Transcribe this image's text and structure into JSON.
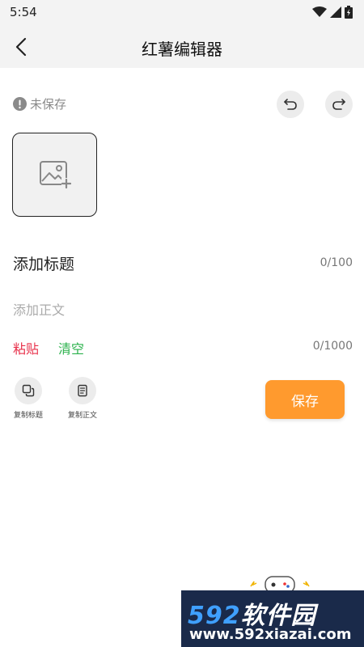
{
  "status_bar": {
    "time": "5:54"
  },
  "app_bar": {
    "title": "红薯编辑器"
  },
  "editor": {
    "save_status": "未保存",
    "title_placeholder": "添加标题",
    "title_count": "0/100",
    "body_placeholder": "添加正文",
    "body_count": "0/1000",
    "paste_label": "粘贴",
    "clear_label": "清空"
  },
  "tools": {
    "copy_title_label": "复制标题",
    "copy_body_label": "复制正文"
  },
  "save_button": {
    "label": "保存"
  },
  "watermark": {
    "brand_number": "592",
    "brand_text": "软件园",
    "url": "www.592xiazai.com"
  },
  "colors": {
    "accent_orange": "#ff9a2e",
    "paste_red": "#e8304a",
    "clear_green": "#2bb24c",
    "bar_bg": "#f3f3f3"
  },
  "icons": [
    "wifi-icon",
    "signal-icon",
    "battery-icon",
    "back-arrow-icon",
    "alert-icon",
    "undo-icon",
    "redo-icon",
    "add-image-icon",
    "copy-title-icon",
    "copy-body-icon",
    "gamepad-mascot-icon"
  ]
}
